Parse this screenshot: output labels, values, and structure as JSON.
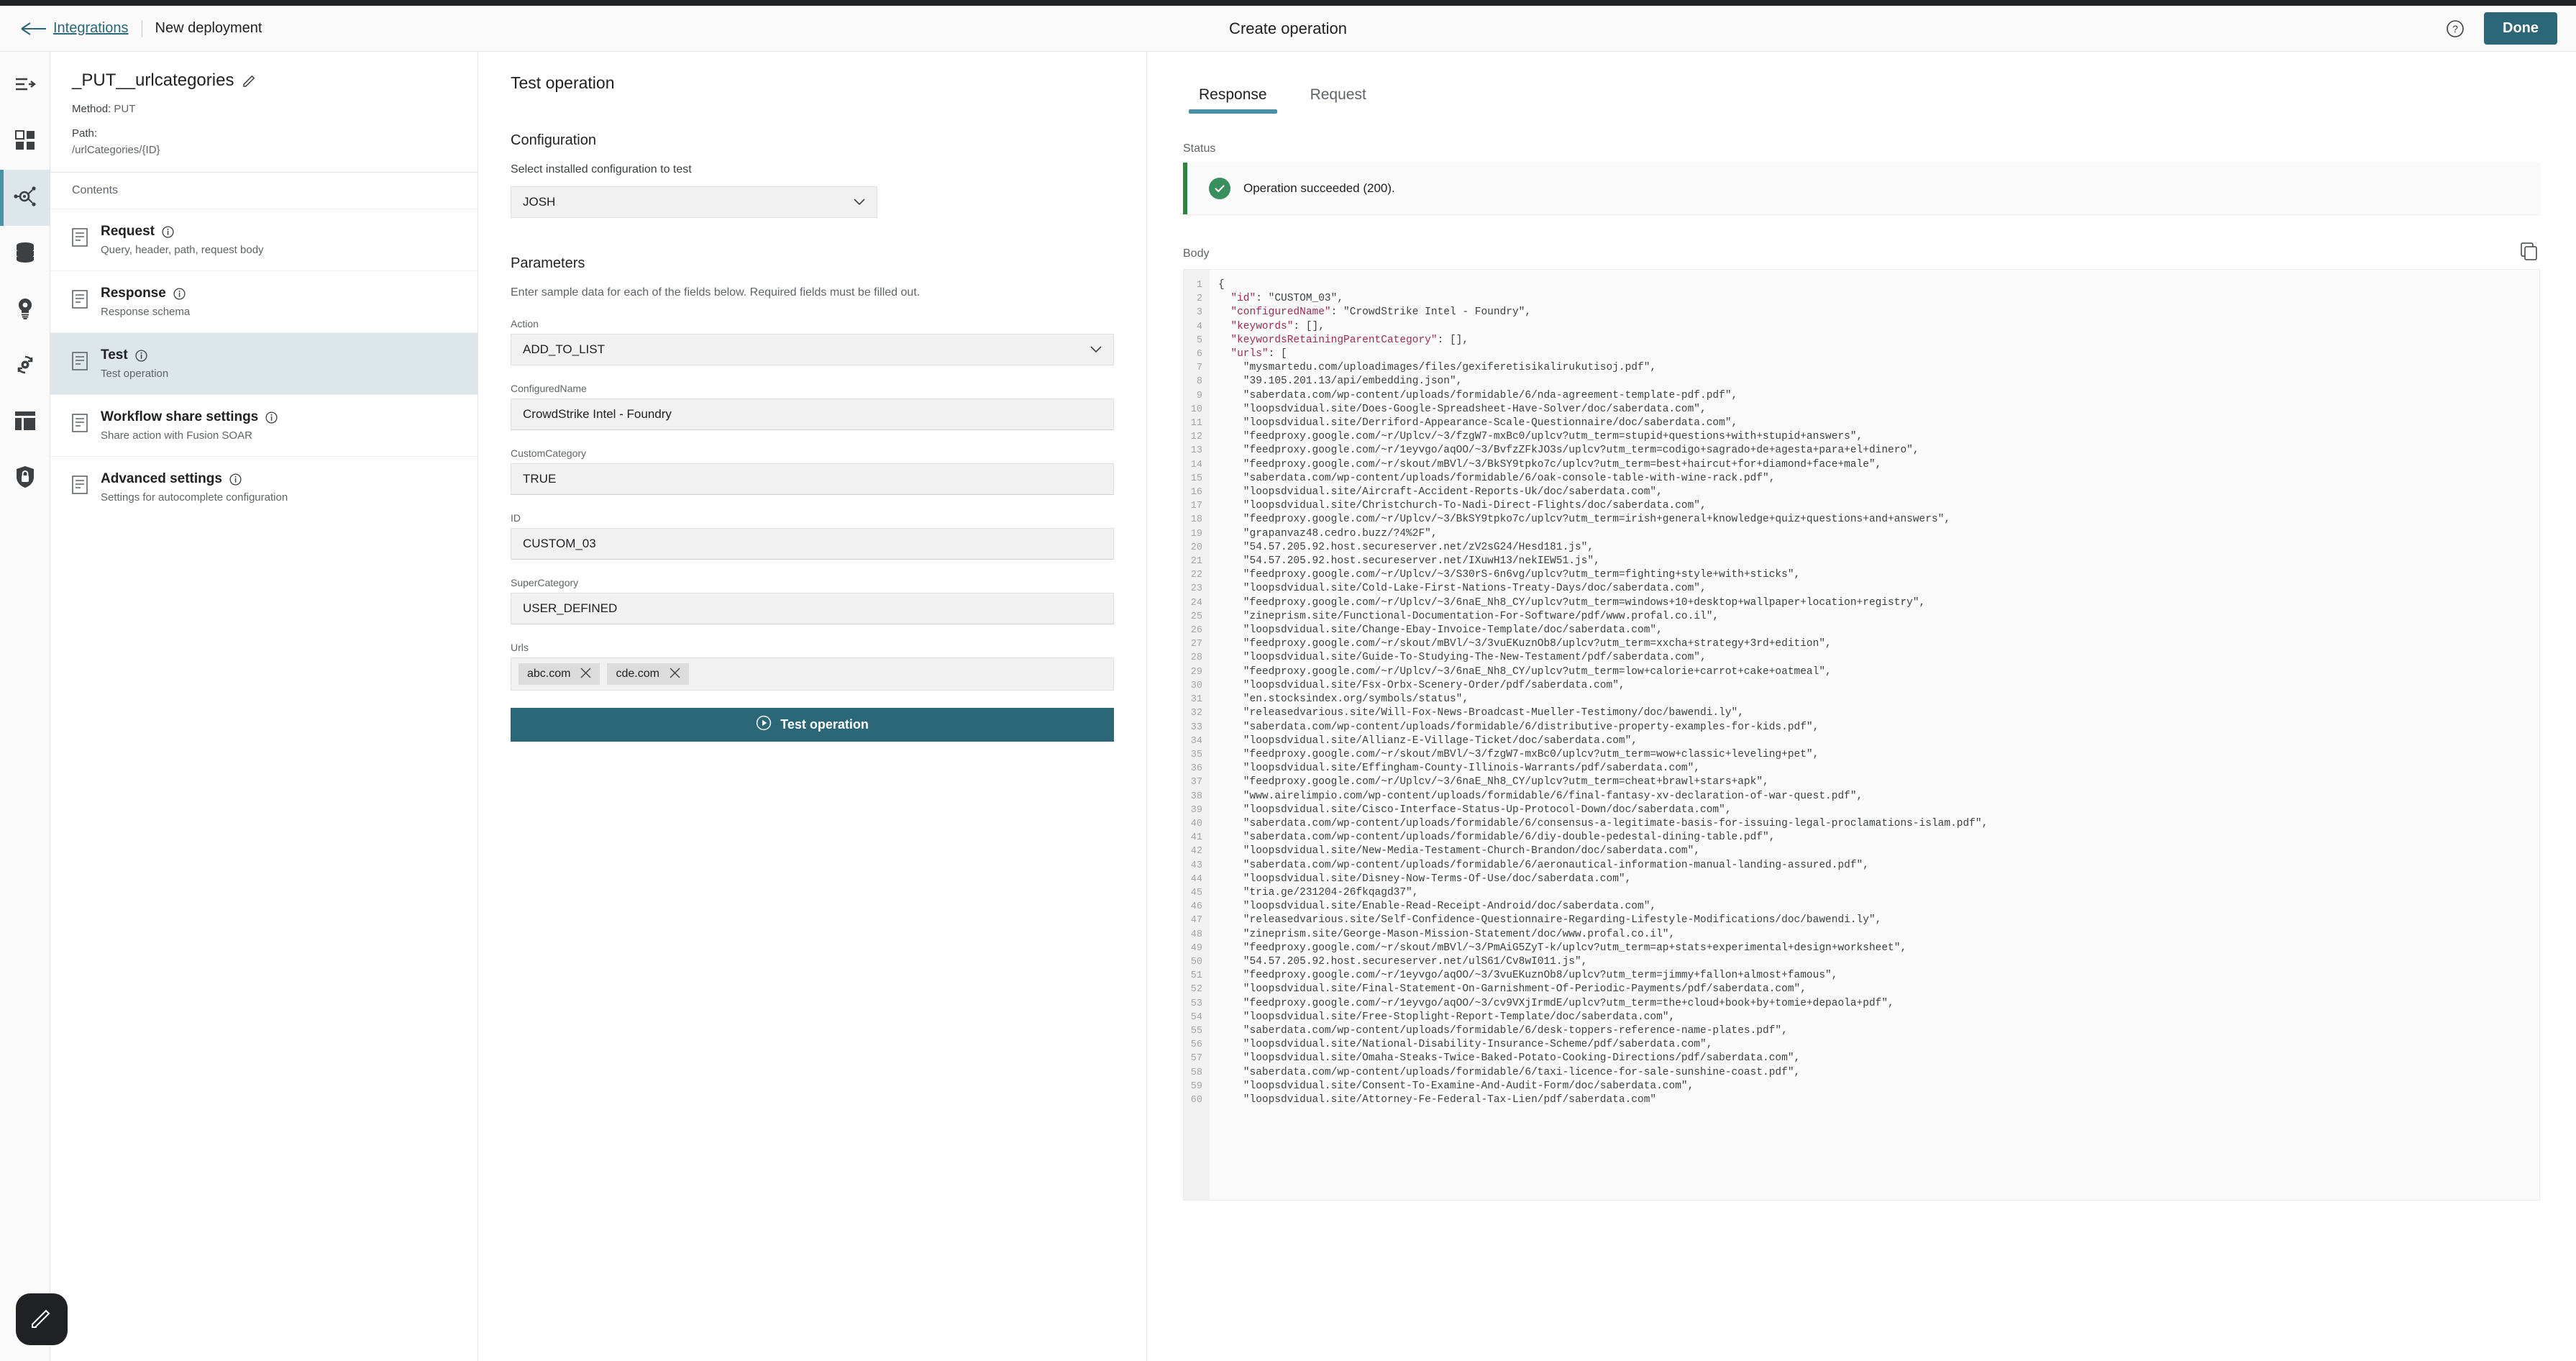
{
  "header": {
    "breadcrumb_link": "Integrations",
    "breadcrumb_current": "New deployment",
    "title": "Create operation",
    "help_label": "?",
    "done_label": "Done"
  },
  "rail": {
    "items": [
      {
        "name": "flow-icon",
        "label": "Flow"
      },
      {
        "name": "apps-grid-icon",
        "label": "Apps"
      },
      {
        "name": "integrations-icon",
        "label": "Integrations"
      },
      {
        "name": "database-icon",
        "label": "Data"
      },
      {
        "name": "insights-bulb-icon",
        "label": "Insights"
      },
      {
        "name": "automation-gear-icon",
        "label": "Automation"
      },
      {
        "name": "layout-icon",
        "label": "Layout"
      },
      {
        "name": "shield-lock-icon",
        "label": "Security"
      }
    ],
    "active_index": 2
  },
  "left_panel": {
    "operation_name": "_PUT__urlcategories",
    "method_label": "Method:",
    "method_value": "PUT",
    "path_label": "Path:",
    "path_value": "/urlCategories/{ID}",
    "contents_label": "Contents",
    "items": [
      {
        "title": "Request",
        "desc": "Query, header, path, request body",
        "active": false
      },
      {
        "title": "Response",
        "desc": "Response schema",
        "active": false
      },
      {
        "title": "Test",
        "desc": "Test operation",
        "active": true
      },
      {
        "title": "Workflow share settings",
        "desc": "Share action with Fusion SOAR",
        "active": false
      },
      {
        "title": "Advanced settings",
        "desc": "Settings for autocomplete configuration",
        "active": false
      }
    ]
  },
  "mid_panel": {
    "heading": "Test operation",
    "configuration_heading": "Configuration",
    "configuration_sub": "Select installed configuration to test",
    "configuration_value": "JOSH",
    "parameters_heading": "Parameters",
    "parameters_help": "Enter sample data for each of the fields below. Required fields must be filled out.",
    "fields": [
      {
        "label": "Action",
        "value": "ADD_TO_LIST",
        "type": "select"
      },
      {
        "label": "ConfiguredName",
        "value": "CrowdStrike Intel - Foundry",
        "type": "text"
      },
      {
        "label": "CustomCategory",
        "value": "TRUE",
        "type": "text"
      },
      {
        "label": "ID",
        "value": "CUSTOM_03",
        "type": "text"
      },
      {
        "label": "SuperCategory",
        "value": "USER_DEFINED",
        "type": "text"
      }
    ],
    "urls_label": "Urls",
    "url_chips": [
      "abc.com",
      "cde.com"
    ],
    "test_button_label": "Test operation"
  },
  "right_panel": {
    "tabs": [
      {
        "label": "Response",
        "active": true
      },
      {
        "label": "Request",
        "active": false
      }
    ],
    "status_label": "Status",
    "status_text": "Operation succeeded (200).",
    "status_color": "#388e5c",
    "body_label": "Body",
    "copy_icon": "copy-icon",
    "response_body": {
      "id": "CUSTOM_03",
      "configuredName": "CrowdStrike Intel - Foundry",
      "keywords": [],
      "keywordsRetainingParentCategory": [],
      "urls": [
        "mysmartedu.com/uploadimages/files/gexiferetisikalirukutisoj.pdf",
        "39.105.201.13/api/embedding.json",
        "saberdata.com/wp-content/uploads/formidable/6/nda-agreement-template-pdf.pdf",
        "loopsdvidual.site/Does-Google-Spreadsheet-Have-Solver/doc/saberdata.com",
        "loopsdvidual.site/Derriford-Appearance-Scale-Questionnaire/doc/saberdata.com",
        "feedproxy.google.com/~r/Uplcv/~3/fzgW7-mxBc0/uplcv?utm_term=stupid+questions+with+stupid+answers",
        "feedproxy.google.com/~r/1eyvgo/aqOO/~3/BvfzZFkJO3s/uplcv?utm_term=codigo+sagrado+de+agesta+para+el+dinero",
        "feedproxy.google.com/~r/skout/mBVl/~3/BkSY9tpko7c/uplcv?utm_term=best+haircut+for+diamond+face+male",
        "saberdata.com/wp-content/uploads/formidable/6/oak-console-table-with-wine-rack.pdf",
        "loopsdvidual.site/Aircraft-Accident-Reports-Uk/doc/saberdata.com",
        "loopsdvidual.site/Christchurch-To-Nadi-Direct-Flights/doc/saberdata.com",
        "feedproxy.google.com/~r/Uplcv/~3/BkSY9tpko7c/uplcv?utm_term=irish+general+knowledge+quiz+questions+and+answers",
        "grapanvaz48.cedro.buzz/?4%2F",
        "54.57.205.92.host.secureserver.net/zV2sG24/Hesd181.js",
        "54.57.205.92.host.secureserver.net/IXuwH13/nekIEW51.js",
        "feedproxy.google.com/~r/Uplcv/~3/S30rS-6n6vg/uplcv?utm_term=fighting+style+with+sticks",
        "loopsdvidual.site/Cold-Lake-First-Nations-Treaty-Days/doc/saberdata.com",
        "feedproxy.google.com/~r/Uplcv/~3/6naE_Nh8_CY/uplcv?utm_term=windows+10+desktop+wallpaper+location+registry",
        "zineprism.site/Functional-Documentation-For-Software/pdf/www.profal.co.il",
        "loopsdvidual.site/Change-Ebay-Invoice-Template/doc/saberdata.com",
        "feedproxy.google.com/~r/skout/mBVl/~3/3vuEKuznOb8/uplcv?utm_term=xxcha+strategy+3rd+edition",
        "loopsdvidual.site/Guide-To-Studying-The-New-Testament/pdf/saberdata.com",
        "feedproxy.google.com/~r/Uplcv/~3/6naE_Nh8_CY/uplcv?utm_term=low+calorie+carrot+cake+oatmeal",
        "loopsdvidual.site/Fsx-Orbx-Scenery-Order/pdf/saberdata.com",
        "en.stocksindex.org/symbols/status",
        "releasedvarious.site/Will-Fox-News-Broadcast-Mueller-Testimony/doc/bawendi.ly",
        "saberdata.com/wp-content/uploads/formidable/6/distributive-property-examples-for-kids.pdf",
        "loopsdvidual.site/Allianz-E-Village-Ticket/doc/saberdata.com",
        "feedproxy.google.com/~r/skout/mBVl/~3/fzgW7-mxBc0/uplcv?utm_term=wow+classic+leveling+pet",
        "loopsdvidual.site/Effingham-County-Illinois-Warrants/pdf/saberdata.com",
        "feedproxy.google.com/~r/Uplcv/~3/6naE_Nh8_CY/uplcv?utm_term=cheat+brawl+stars+apk",
        "www.airelimpio.com/wp-content/uploads/formidable/6/final-fantasy-xv-declaration-of-war-quest.pdf",
        "loopsdvidual.site/Cisco-Interface-Status-Up-Protocol-Down/doc/saberdata.com",
        "saberdata.com/wp-content/uploads/formidable/6/consensus-a-legitimate-basis-for-issuing-legal-proclamations-islam.pdf",
        "saberdata.com/wp-content/uploads/formidable/6/diy-double-pedestal-dining-table.pdf",
        "loopsdvidual.site/New-Media-Testament-Church-Brandon/doc/saberdata.com",
        "saberdata.com/wp-content/uploads/formidable/6/aeronautical-information-manual-landing-assured.pdf",
        "loopsdvidual.site/Disney-Now-Terms-Of-Use/doc/saberdata.com",
        "tria.ge/231204-26fkqagd37",
        "loopsdvidual.site/Enable-Read-Receipt-Android/doc/saberdata.com",
        "releasedvarious.site/Self-Confidence-Questionnaire-Regarding-Lifestyle-Modifications/doc/bawendi.ly",
        "zineprism.site/George-Mason-Mission-Statement/doc/www.profal.co.il",
        "feedproxy.google.com/~r/skout/mBVl/~3/PmAiG5ZyT-k/uplcv?utm_term=ap+stats+experimental+design+worksheet",
        "54.57.205.92.host.secureserver.net/ulS61/Cv8wI011.js",
        "feedproxy.google.com/~r/1eyvgo/aqOO/~3/3vuEKuznOb8/uplcv?utm_term=jimmy+fallon+almost+famous",
        "loopsdvidual.site/Final-Statement-On-Garnishment-Of-Periodic-Payments/pdf/saberdata.com",
        "feedproxy.google.com/~r/1eyvgo/aqOO/~3/cv9VXjIrmdE/uplcv?utm_term=the+cloud+book+by+tomie+depaola+pdf",
        "loopsdvidual.site/Free-Stoplight-Report-Template/doc/saberdata.com",
        "saberdata.com/wp-content/uploads/formidable/6/desk-toppers-reference-name-plates.pdf",
        "loopsdvidual.site/National-Disability-Insurance-Scheme/pdf/saberdata.com",
        "loopsdvidual.site/Omaha-Steaks-Twice-Baked-Potato-Cooking-Directions/pdf/saberdata.com",
        "saberdata.com/wp-content/uploads/formidable/6/taxi-licence-for-sale-sunshine-coast.pdf",
        "loopsdvidual.site/Consent-To-Examine-And-Audit-Form/doc/saberdata.com",
        "loopsdvidual.site/Attorney-Fe-Federal-Tax-Lien/pdf/saberdata.com"
      ]
    }
  },
  "fab": {
    "icon": "edit-pencil-icon"
  }
}
